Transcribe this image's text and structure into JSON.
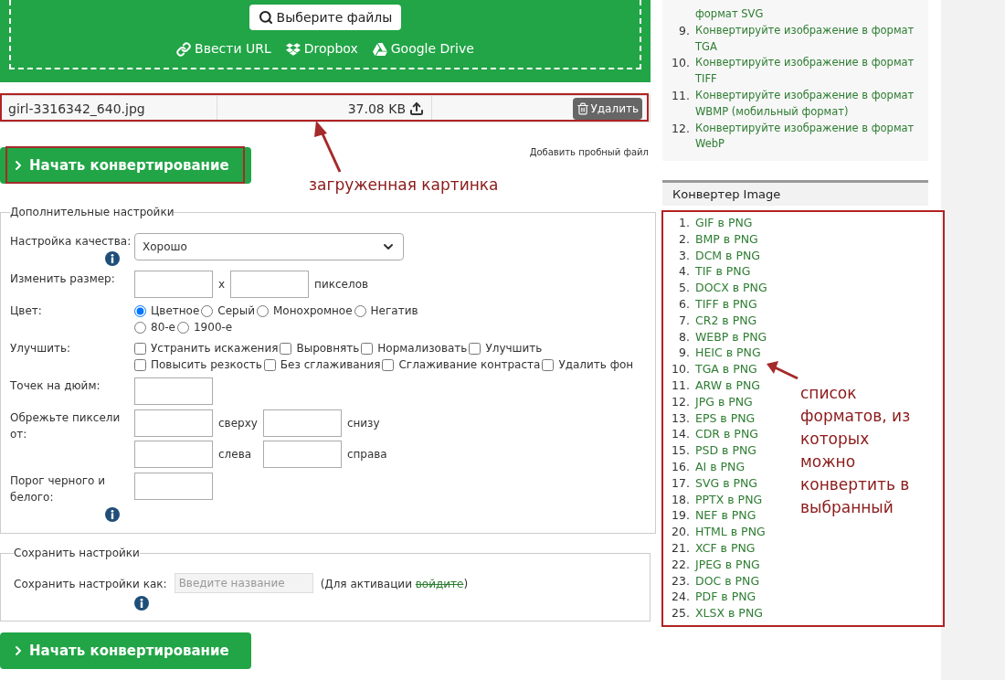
{
  "upload": {
    "choose_button": "Выберите файлы",
    "sources": [
      {
        "kind": "url",
        "label": "Ввести URL"
      },
      {
        "kind": "dropbox",
        "label": "Dropbox"
      },
      {
        "kind": "drive",
        "label": "Google Drive"
      }
    ]
  },
  "file": {
    "name": "girl-3316342_640.jpg",
    "size": "37.08 KB",
    "delete_button": "Удалить"
  },
  "start_button": "Начать конвертирование",
  "sample_link": "Добавить пробный файл",
  "annotations": [
    {
      "kind": "file",
      "text": "загруженная картинка"
    },
    {
      "kind": "list",
      "text": "список форматов, из которых можно конвертить в выбранный"
    }
  ],
  "settings": {
    "legend": "Дополнительные настройки",
    "rows": [
      {
        "kind": "select",
        "label": "Настройка качества:",
        "info": true,
        "value": "Хорошо"
      },
      {
        "kind": "size",
        "label": "Изменить размер:",
        "separator": "x",
        "unit": "пикселов"
      },
      {
        "kind": "radio",
        "label": "Цвет:",
        "options": [
          {
            "label": "Цветное",
            "selected": true
          },
          {
            "label": "Серый",
            "selected": false
          },
          {
            "label": "Монохромное",
            "selected": false
          },
          {
            "label": "Негатив",
            "selected": false
          },
          {
            "label": "80-е",
            "selected": false
          },
          {
            "label": "1900-е",
            "selected": false
          }
        ]
      },
      {
        "kind": "checkbox",
        "label": "Улучшить:",
        "options": [
          {
            "label": "Устранить искажения",
            "checked": false
          },
          {
            "label": "Выровнять",
            "checked": false
          },
          {
            "label": "Нормализовать",
            "checked": false
          },
          {
            "label": "Улучшить",
            "checked": false
          },
          {
            "label": "Повысить резкость",
            "checked": false
          },
          {
            "label": "Без сглаживания",
            "checked": false
          },
          {
            "label": "Сглаживание контраста",
            "checked": false
          },
          {
            "label": "Удалить фон",
            "checked": false
          }
        ]
      },
      {
        "kind": "input",
        "label": "Точек на дюйм:",
        "info": false
      },
      {
        "kind": "crop",
        "label": "Обрежьте пиксели от:",
        "sides": [
          "сверху",
          "снизу",
          "слева",
          "справа"
        ]
      },
      {
        "kind": "input",
        "label": "Порог черного и белого:",
        "info": true
      }
    ]
  },
  "save": {
    "legend": "Сохранить настройки",
    "label": "Сохранить настройки как:",
    "placeholder": "Введите название",
    "note_before": "(Для активации ",
    "link": "войдите",
    "note_after": ")"
  },
  "start_button_bottom": "Начать конвертирование",
  "related": {
    "items": [
      {
        "text": "формат SVG"
      },
      {
        "number": "9.",
        "text": "Конвертируйте изображение в формат TGA"
      },
      {
        "number": "10.",
        "text": "Конвертируйте изображение в формат TIFF"
      },
      {
        "number": "11.",
        "text": "Конвертируйте изображение в формат WBMP (мобильный формат)"
      },
      {
        "number": "12.",
        "text": "Конвертируйте изображение в формат WebP"
      }
    ]
  },
  "converter": {
    "title": "Конвертер Image",
    "items": [
      {
        "number": "1.",
        "text": "GIF в PNG"
      },
      {
        "number": "2.",
        "text": "BMP в PNG"
      },
      {
        "number": "3.",
        "text": "DCM в PNG"
      },
      {
        "number": "4.",
        "text": "TIF в PNG"
      },
      {
        "number": "5.",
        "text": "DOCX в PNG"
      },
      {
        "number": "6.",
        "text": "TIFF в PNG"
      },
      {
        "number": "7.",
        "text": "CR2 в PNG"
      },
      {
        "number": "8.",
        "text": "WEBP в PNG"
      },
      {
        "number": "9.",
        "text": "HEIC в PNG"
      },
      {
        "number": "10.",
        "text": "TGA в PNG"
      },
      {
        "number": "11.",
        "text": "ARW в PNG"
      },
      {
        "number": "12.",
        "text": "JPG в PNG"
      },
      {
        "number": "13.",
        "text": "EPS в PNG"
      },
      {
        "number": "14.",
        "text": "CDR в PNG"
      },
      {
        "number": "15.",
        "text": "PSD в PNG"
      },
      {
        "number": "16.",
        "text": "AI в PNG"
      },
      {
        "number": "17.",
        "text": "SVG в PNG"
      },
      {
        "number": "18.",
        "text": "PPTX в PNG"
      },
      {
        "number": "19.",
        "text": "NEF в PNG"
      },
      {
        "number": "20.",
        "text": "HTML в PNG"
      },
      {
        "number": "21.",
        "text": "XCF в PNG"
      },
      {
        "number": "22.",
        "text": "JPEG в PNG"
      },
      {
        "number": "23.",
        "text": "DOC в PNG"
      },
      {
        "number": "24.",
        "text": "PDF в PNG"
      },
      {
        "number": "25.",
        "text": "XLSX в PNG"
      }
    ]
  }
}
